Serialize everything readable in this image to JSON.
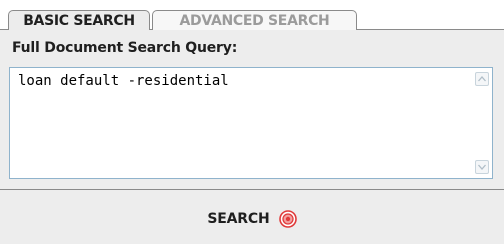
{
  "tabs": [
    {
      "label": "BASIC SEARCH",
      "active": true
    },
    {
      "label": "ADVANCED SEARCH",
      "active": false
    }
  ],
  "query": {
    "label": "Full Document Search Query:",
    "value": "loan default -residential"
  },
  "search_button": {
    "label": "SEARCH",
    "icon": "target-icon"
  },
  "colors": {
    "panel_background": "#ededed",
    "active_tab_text": "#1f1f1f",
    "inactive_tab_text": "#9b9b9b",
    "textarea_border": "#8fb3cc",
    "search_icon_accent": "#e03a3a"
  }
}
